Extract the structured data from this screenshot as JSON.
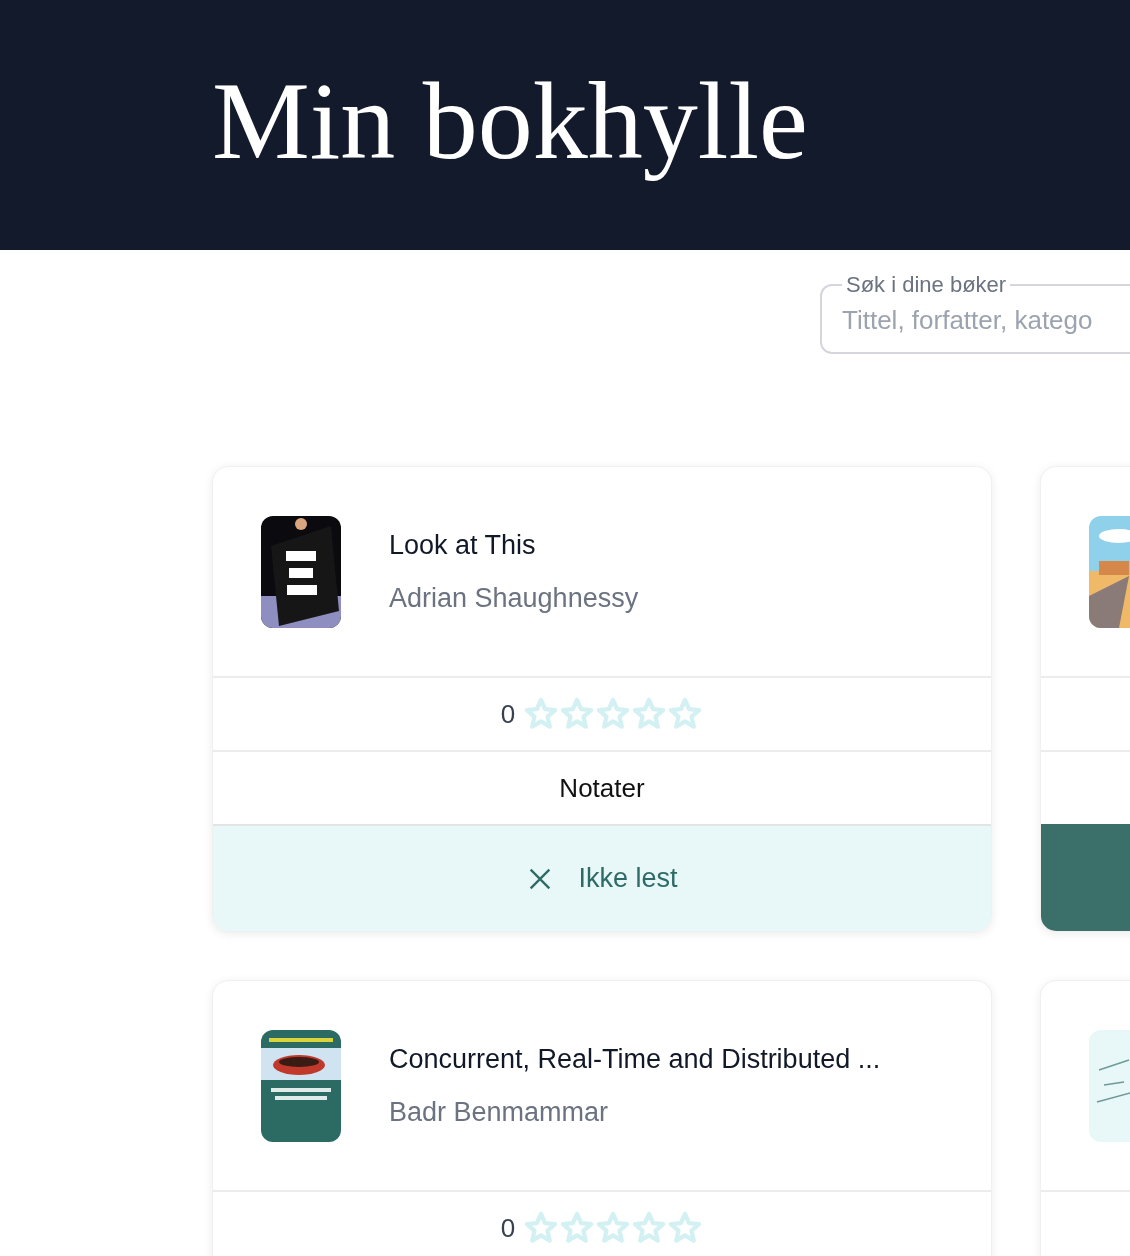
{
  "header": {
    "title": "Min bokhylle"
  },
  "search": {
    "label": "Søk i dine bøker",
    "placeholder": "Tittel, forfatter, katego"
  },
  "books": [
    {
      "cover": {
        "kind": "picture"
      },
      "title": "Look at This",
      "author": "Adrian Shaughnessy",
      "rating": "0",
      "stars": 0,
      "notes_label": "Notater",
      "read": false,
      "status_label": "Ikke lest"
    },
    {
      "cover": {
        "kind": "picture"
      },
      "read": true
    },
    {
      "cover": {
        "kind": "picture"
      },
      "title": "Concurrent, Real-Time and Distributed ...",
      "author": "Badr Benmammar",
      "rating": "0",
      "stars": 0
    },
    {
      "cover": {
        "kind": "picture"
      }
    }
  ]
}
